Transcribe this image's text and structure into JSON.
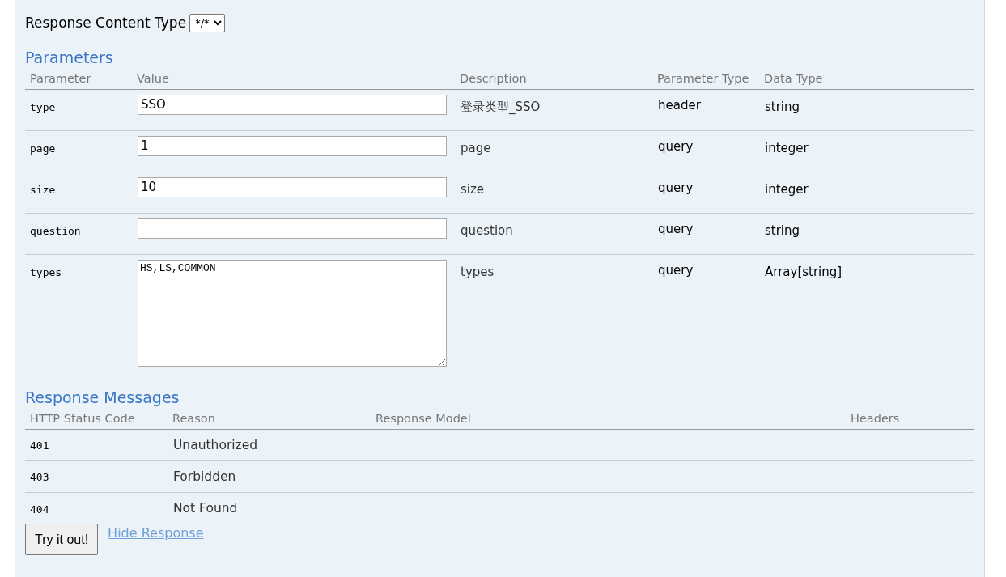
{
  "content_type": {
    "label": "Response Content Type",
    "value": "*/*"
  },
  "parameters": {
    "title": "Parameters",
    "columns": [
      "Parameter",
      "Value",
      "Description",
      "Parameter Type",
      "Data Type"
    ],
    "rows": [
      {
        "name": "type",
        "kind": "input",
        "value": "SSO",
        "description": "登录类型_SSO",
        "param_type": "header",
        "data_type": "string"
      },
      {
        "name": "page",
        "kind": "input",
        "value": "1",
        "description": "page",
        "param_type": "query",
        "data_type": "integer"
      },
      {
        "name": "size",
        "kind": "input",
        "value": "10",
        "description": "size",
        "param_type": "query",
        "data_type": "integer"
      },
      {
        "name": "question",
        "kind": "input",
        "description": "question",
        "param_type": "query",
        "data_type": "string"
      },
      {
        "name": "types",
        "kind": "textarea",
        "value": "HS,LS,COMMON",
        "description": "types",
        "param_type": "query",
        "data_type": "Array[string]"
      }
    ]
  },
  "responses": {
    "title": "Response Messages",
    "columns": [
      "HTTP Status Code",
      "Reason",
      "Response Model",
      "Headers"
    ],
    "rows": [
      {
        "code": "401",
        "reason": "Unauthorized"
      },
      {
        "code": "403",
        "reason": "Forbidden"
      },
      {
        "code": "404",
        "reason": "Not Found"
      }
    ]
  },
  "actions": {
    "button": "Try it out!",
    "link": "Hide Response"
  }
}
